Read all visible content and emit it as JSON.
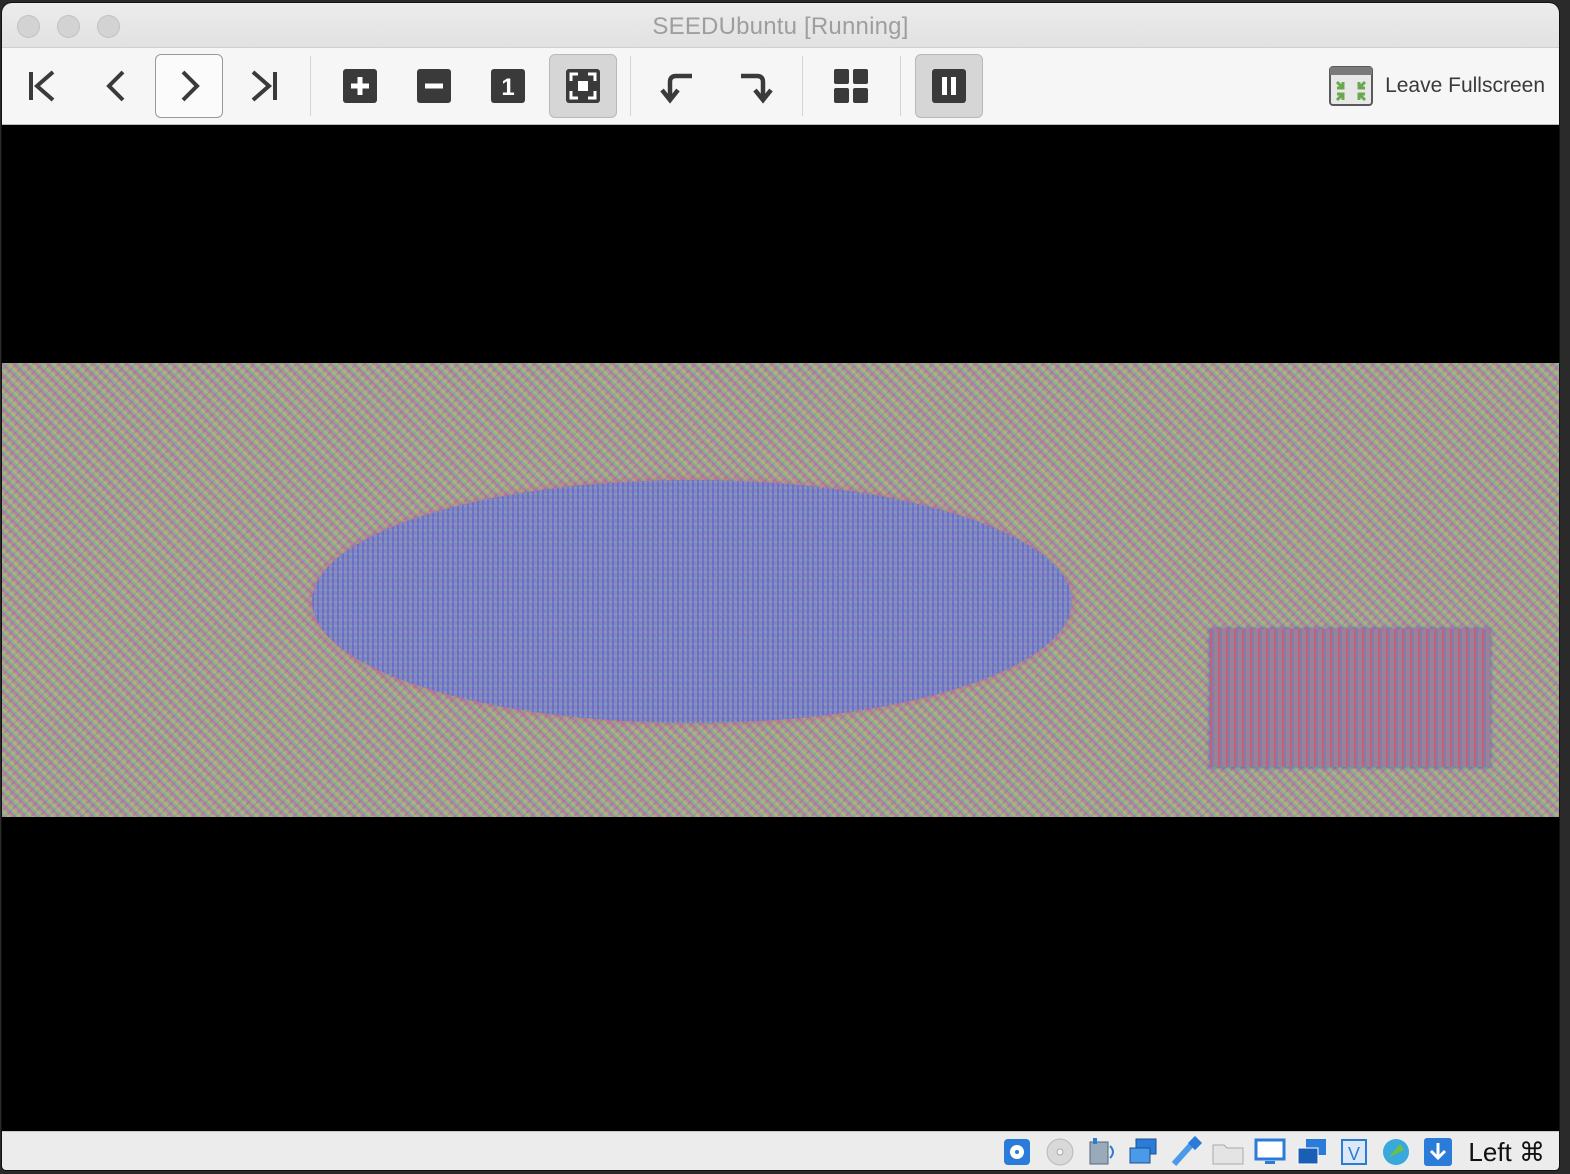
{
  "window": {
    "title": "SEEDUbuntu [Running]"
  },
  "toolbar": {
    "buttons": [
      {
        "name": "first-page-icon"
      },
      {
        "name": "previous-page-icon"
      },
      {
        "name": "next-page-icon"
      },
      {
        "name": "last-page-icon"
      },
      {
        "name": "zoom-in-icon"
      },
      {
        "name": "zoom-out-icon"
      },
      {
        "name": "actual-size-icon",
        "label": "1"
      },
      {
        "name": "best-fit-icon"
      },
      {
        "name": "rotate-left-icon"
      },
      {
        "name": "rotate-right-icon"
      },
      {
        "name": "gallery-icon"
      },
      {
        "name": "pause-icon"
      }
    ],
    "leave_fullscreen_label": "Leave Fullscreen"
  },
  "statusbar": {
    "icons": [
      "hard-disk-icon",
      "optical-drive-icon",
      "audio-icon",
      "network-icon",
      "usb-icon",
      "shared-folders-icon",
      "display-icon",
      "vm-windows-icon",
      "virtualization-icon",
      "recording-icon",
      "mouse-integration-icon"
    ],
    "host_key_label": "Left ⌘"
  },
  "colors": {
    "titlebar": "#e6e6e6",
    "toolbar": "#f6f6f6",
    "display_background": "#000000",
    "statusbar": "#ececec"
  }
}
